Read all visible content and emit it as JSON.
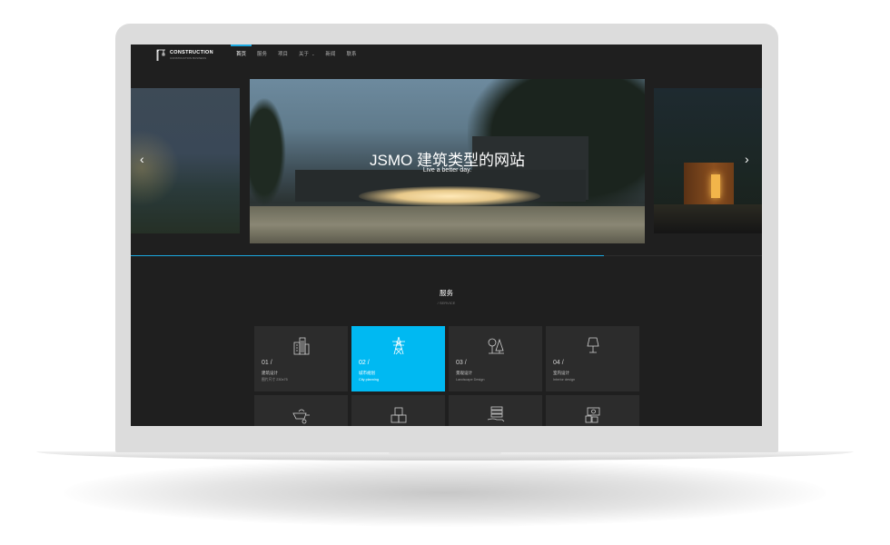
{
  "nav": {
    "logo_title": "CONSTRUCTION",
    "logo_sub": "CONSTRUCTION BUSINESS",
    "items": [
      {
        "label": "首页",
        "active": true
      },
      {
        "label": "服务"
      },
      {
        "label": "项目"
      },
      {
        "label": "关于",
        "has_dropdown": true
      },
      {
        "label": "新闻"
      },
      {
        "label": "联系"
      }
    ]
  },
  "slider": {
    "title": "JSMO 建筑类型的网站",
    "subtitle": "Live a better day.",
    "prev_icon": "chevron-left-icon",
    "next_icon": "chevron-right-icon",
    "progress": 0.75
  },
  "services": {
    "title": "服务",
    "subtitle": "/ SERVICE",
    "cards": [
      {
        "num": "01 /",
        "title": "建筑设计",
        "sub": "图片尺寸 230x75",
        "icon": "buildings-icon",
        "active": false
      },
      {
        "num": "02 /",
        "title": "城市规划",
        "sub": "City planning",
        "icon": "power-tower-icon",
        "active": true
      },
      {
        "num": "03 /",
        "title": "景观设计",
        "sub": "Landscape Design",
        "icon": "trees-icon",
        "active": false
      },
      {
        "num": "04 /",
        "title": "室内设计",
        "sub": "Interior design",
        "icon": "lamp-icon",
        "active": false
      },
      {
        "icon": "wheelbarrow-icon",
        "active": false
      },
      {
        "icon": "boxes-icon",
        "active": false
      },
      {
        "icon": "hand-stack-icon",
        "active": false
      },
      {
        "icon": "money-stack-icon",
        "active": false
      }
    ]
  },
  "colors": {
    "accent": "#00b9f2",
    "background": "#1f1f1f",
    "card": "#2c2c2c"
  }
}
